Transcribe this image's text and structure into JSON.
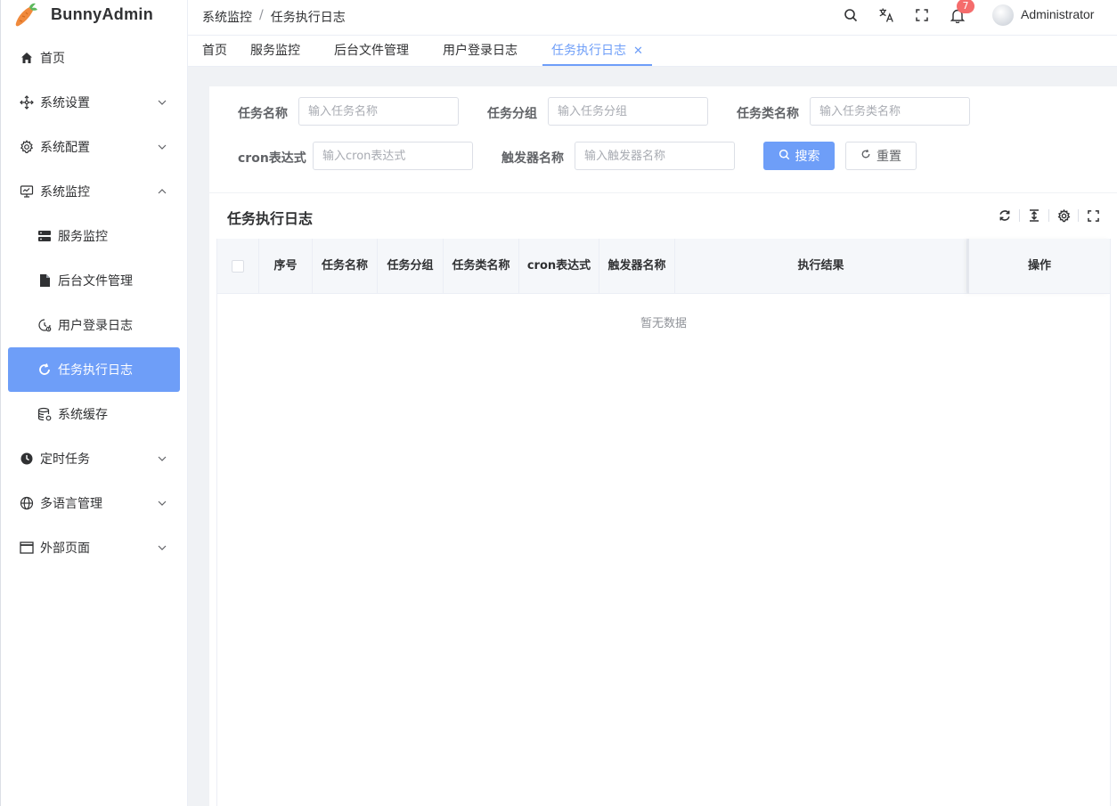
{
  "app": {
    "title": "BunnyAdmin"
  },
  "sidebar": {
    "items": [
      {
        "label": "首页",
        "icon": "home-icon"
      },
      {
        "label": "系统设置",
        "icon": "settings-move-icon",
        "expandable": true
      },
      {
        "label": "系统配置",
        "icon": "gear-icon",
        "expandable": true
      },
      {
        "label": "系统监控",
        "icon": "monitor-icon",
        "expandable": true,
        "expanded": true,
        "children": [
          {
            "label": "服务监控",
            "icon": "server-icon"
          },
          {
            "label": "后台文件管理",
            "icon": "file-icon"
          },
          {
            "label": "用户登录日志",
            "icon": "clock-history-icon"
          },
          {
            "label": "任务执行日志",
            "icon": "refresh-icon",
            "active": true
          },
          {
            "label": "系统缓存",
            "icon": "database-icon"
          }
        ]
      },
      {
        "label": "定时任务",
        "icon": "clock-icon",
        "expandable": true
      },
      {
        "label": "多语言管理",
        "icon": "globe-icon",
        "expandable": true
      },
      {
        "label": "外部页面",
        "icon": "window-icon",
        "expandable": true
      }
    ]
  },
  "header": {
    "breadcrumb": [
      "系统监控",
      "任务执行日志"
    ],
    "breadcrumb_separator": "/",
    "notification_count": "7",
    "username": "Administrator"
  },
  "tabs": [
    {
      "label": "首页"
    },
    {
      "label": "服务监控"
    },
    {
      "label": "后台文件管理"
    },
    {
      "label": "用户登录日志"
    },
    {
      "label": "任务执行日志",
      "active": true,
      "closable": true
    }
  ],
  "search": {
    "fields": [
      {
        "label": "任务名称",
        "placeholder": "输入任务名称",
        "value": ""
      },
      {
        "label": "任务分组",
        "placeholder": "输入任务分组",
        "value": ""
      },
      {
        "label": "任务类名称",
        "placeholder": "输入任务类名称",
        "value": ""
      },
      {
        "label": "cron表达式",
        "placeholder": "输入cron表达式",
        "value": ""
      },
      {
        "label": "触发器名称",
        "placeholder": "输入触发器名称",
        "value": ""
      }
    ],
    "search_button": "搜索",
    "reset_button": "重置"
  },
  "table": {
    "title": "任务执行日志",
    "columns": [
      "序号",
      "任务名称",
      "任务分组",
      "任务类名称",
      "cron表达式",
      "触发器名称",
      "执行结果",
      "操作"
    ],
    "header_lines": {
      "任务名称": [
        "任务名",
        "称"
      ],
      "任务分组": [
        "任务分",
        "组"
      ],
      "任务类名称": [
        "任务类名",
        "称"
      ],
      "cron表达式": [
        "cron表达",
        "式"
      ],
      "触发器名称": [
        "触发器名",
        "称"
      ]
    },
    "empty_text": "暂无数据",
    "rows": []
  },
  "colors": {
    "accent": "#6e9ef8",
    "badge": "#f56c6c",
    "page_bg": "#f0f2f5"
  }
}
